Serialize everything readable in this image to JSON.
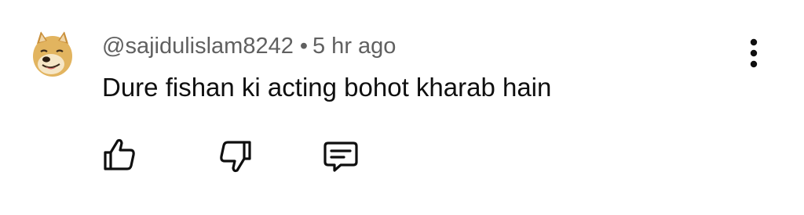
{
  "comment": {
    "author": "@sajidulislam8242",
    "separator": "•",
    "time": "5 hr ago",
    "text": "Dure fishan ki acting bohot kharab hain"
  },
  "icons": {
    "avatar": "doge-avatar",
    "more": "more-vertical-icon",
    "like": "thumbs-up-icon",
    "dislike": "thumbs-down-icon",
    "reply": "comment-reply-icon"
  }
}
